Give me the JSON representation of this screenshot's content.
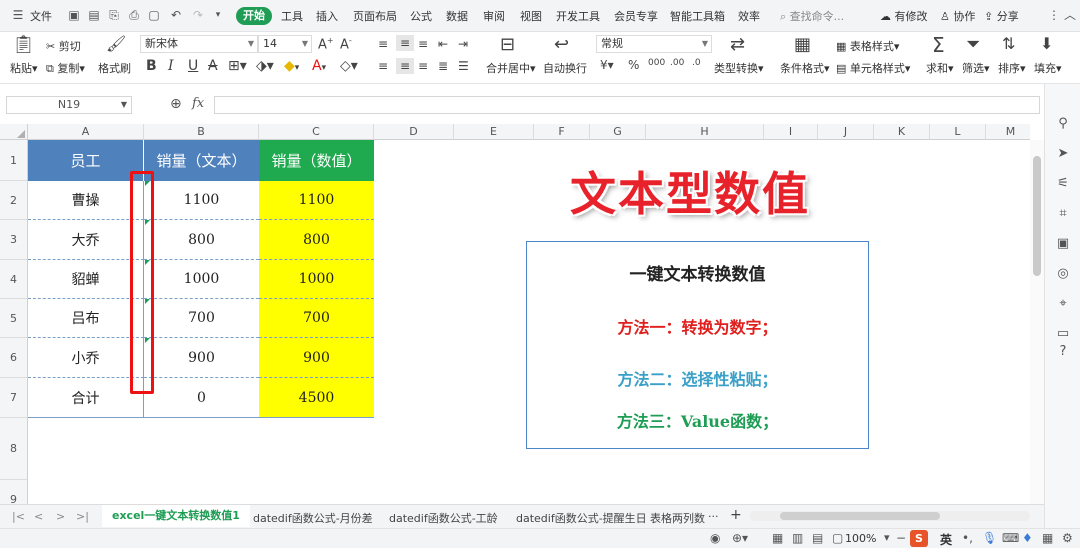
{
  "menubar": {
    "file": "文件",
    "tabs": [
      "开始",
      "工具",
      "插入",
      "页面布局",
      "公式",
      "数据",
      "审阅",
      "视图",
      "开发工具",
      "会员专享",
      "智能工具箱",
      "效率"
    ],
    "search_placeholder": "查找命令...",
    "right": [
      "有修改",
      "协作",
      "分享"
    ]
  },
  "ribbon": {
    "paste": "粘贴",
    "cut": "剪切",
    "copy": "复制",
    "format_painter": "格式刷",
    "font_name": "新宋体",
    "font_size": "14",
    "merge_center": "合并居中",
    "wrap_text": "自动换行",
    "number_format": "常规",
    "type_convert": "类型转换",
    "conditional_format": "条件格式",
    "table_style": "表格样式",
    "cell_style": "单元格样式",
    "sum": "求和",
    "filter": "筛选",
    "sort": "排序",
    "fill": "填充"
  },
  "formula_bar": {
    "name_box": "N19",
    "fx": "fx",
    "value": ""
  },
  "columns": [
    "A",
    "B",
    "C",
    "D",
    "E",
    "F",
    "G",
    "H",
    "I",
    "J",
    "K",
    "L",
    "M"
  ],
  "rows": [
    "1",
    "2",
    "3",
    "4",
    "5",
    "6",
    "7",
    "8",
    "9"
  ],
  "table": {
    "headers": [
      "员工",
      "销量（文本）",
      "销量（数值）"
    ],
    "rows": [
      [
        "曹操",
        "1100",
        "1100"
      ],
      [
        "大乔",
        "800",
        "800"
      ],
      [
        "貂蝉",
        "1000",
        "1000"
      ],
      [
        "吕布",
        "700",
        "700"
      ],
      [
        "小乔",
        "900",
        "900"
      ],
      [
        "合计",
        "0",
        "4500"
      ]
    ],
    "colors": {
      "header_blue": "#4f81bd",
      "header_green": "#1faa4f",
      "yellow": "#ffff00"
    }
  },
  "big_title": "文本型数值",
  "info_box": {
    "title": "一键文本转换数值",
    "method1": "方法一：转换为数字；",
    "method2": "方法二：选择性粘贴；",
    "method3": "方法三：Value函数；",
    "colors": {
      "m1": "#e0201e",
      "m2": "#3aa0c8",
      "m3": "#1f9d55"
    }
  },
  "sheet_tabs": [
    "excel一键文本转换数值1",
    "datedif函数公式-月份差",
    "datedif函数公式-工龄",
    "datedif函数公式-提醒生日",
    "表格两列数"
  ],
  "status": {
    "zoom": "100%",
    "ime": "英"
  }
}
